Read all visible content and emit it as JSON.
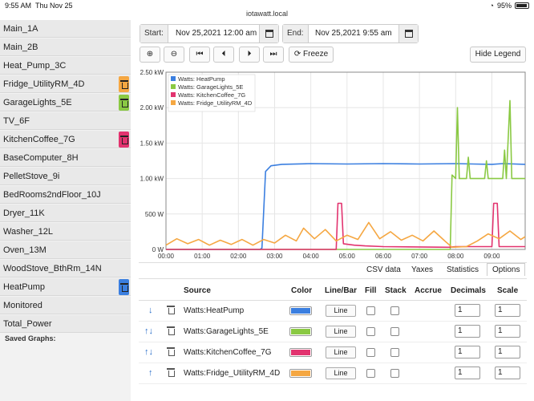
{
  "status": {
    "time": "9:55 AM",
    "date": "Thu Nov 25",
    "battery": "95%"
  },
  "url": "iotawatt.local",
  "sidebar": {
    "items": [
      {
        "label": "Main_1A"
      },
      {
        "label": "Main_2B"
      },
      {
        "label": "Heat_Pump_3C"
      },
      {
        "label": "Fridge_UtilityRM_4D",
        "tag": "#f5a742"
      },
      {
        "label": "GarageLights_5E",
        "tag": "#8ac943"
      },
      {
        "label": "TV_6F"
      },
      {
        "label": "KitchenCoffee_7G",
        "tag": "#e2336f"
      },
      {
        "label": "BaseComputer_8H"
      },
      {
        "label": "PelletStove_9i"
      },
      {
        "label": "BedRooms2ndFloor_10J"
      },
      {
        "label": "Dryer_11K"
      },
      {
        "label": "Washer_12L"
      },
      {
        "label": "Oven_13M"
      },
      {
        "label": "WoodStove_BthRm_14N"
      },
      {
        "label": "HeatPump",
        "tag": "#3b7fe0"
      },
      {
        "label": "Monitored"
      },
      {
        "label": "Total_Power"
      }
    ],
    "saved_label": "Saved Graphs:"
  },
  "controls": {
    "start_label": "Start:",
    "start_value": "Nov 25,2021 12:00 am",
    "end_label": "End:",
    "end_value": "Nov 25,2021 9:55 am",
    "freeze_label": "Freeze",
    "hide_legend_label": "Hide Legend"
  },
  "chart_data": {
    "type": "line",
    "ylabel": "",
    "yticks": [
      "0 W",
      "500 W",
      "1.00 kW",
      "1.50 kW",
      "2.00 kW",
      "2.50 kW"
    ],
    "ylim": [
      0,
      2500
    ],
    "xticks": [
      "00:00",
      "01:00",
      "02:00",
      "03:00",
      "04:00",
      "05:00",
      "06:00",
      "07:00",
      "08:00",
      "09:00"
    ],
    "xlim": [
      0,
      9.92
    ],
    "legend_position": "top-left",
    "series": [
      {
        "name": "Watts: HeatPump",
        "color": "#3b7fe0",
        "points": [
          [
            0,
            0
          ],
          [
            2.6,
            0
          ],
          [
            2.65,
            20
          ],
          [
            2.75,
            1100
          ],
          [
            2.9,
            1180
          ],
          [
            3.2,
            1200
          ],
          [
            4,
            1210
          ],
          [
            5,
            1205
          ],
          [
            6,
            1210
          ],
          [
            7,
            1205
          ],
          [
            8,
            1210
          ],
          [
            8.5,
            1205
          ],
          [
            9,
            1200
          ],
          [
            9.3,
            1210
          ],
          [
            9.92,
            1200
          ]
        ]
      },
      {
        "name": "Watts: GarageLights_5E",
        "color": "#8ac943",
        "points": [
          [
            0,
            0
          ],
          [
            7.85,
            0
          ],
          [
            7.9,
            1050
          ],
          [
            8,
            1000
          ],
          [
            8.05,
            2000
          ],
          [
            8.1,
            1000
          ],
          [
            8.3,
            1000
          ],
          [
            8.35,
            1300
          ],
          [
            8.4,
            1000
          ],
          [
            8.8,
            1000
          ],
          [
            8.85,
            1250
          ],
          [
            8.9,
            1000
          ],
          [
            9.3,
            1000
          ],
          [
            9.35,
            1400
          ],
          [
            9.4,
            1000
          ],
          [
            9.5,
            2100
          ],
          [
            9.55,
            1000
          ],
          [
            9.92,
            1000
          ]
        ]
      },
      {
        "name": "Watts: KitchenCoffee_7G",
        "color": "#e2336f",
        "points": [
          [
            0,
            0
          ],
          [
            4.7,
            0
          ],
          [
            4.75,
            650
          ],
          [
            4.85,
            650
          ],
          [
            4.9,
            80
          ],
          [
            5.2,
            60
          ],
          [
            5.5,
            50
          ],
          [
            6,
            40
          ],
          [
            7.8,
            30
          ],
          [
            8,
            40
          ],
          [
            9.0,
            40
          ],
          [
            9.05,
            650
          ],
          [
            9.15,
            650
          ],
          [
            9.2,
            40
          ],
          [
            9.92,
            40
          ]
        ]
      },
      {
        "name": "Watts: Fridge_UtilityRM_4D",
        "color": "#f5a742",
        "points": [
          [
            0,
            60
          ],
          [
            0.3,
            150
          ],
          [
            0.6,
            80
          ],
          [
            0.9,
            140
          ],
          [
            1.2,
            60
          ],
          [
            1.5,
            130
          ],
          [
            1.8,
            70
          ],
          [
            2.1,
            140
          ],
          [
            2.4,
            60
          ],
          [
            2.7,
            140
          ],
          [
            3,
            90
          ],
          [
            3.3,
            200
          ],
          [
            3.6,
            120
          ],
          [
            3.8,
            300
          ],
          [
            4.1,
            150
          ],
          [
            4.4,
            280
          ],
          [
            4.7,
            120
          ],
          [
            5,
            200
          ],
          [
            5.3,
            140
          ],
          [
            5.6,
            380
          ],
          [
            5.9,
            150
          ],
          [
            6.2,
            250
          ],
          [
            6.5,
            130
          ],
          [
            6.8,
            200
          ],
          [
            7.1,
            120
          ],
          [
            7.4,
            260
          ],
          [
            7.7,
            120
          ],
          [
            7.9,
            30
          ],
          [
            8.3,
            40
          ],
          [
            8.6,
            120
          ],
          [
            8.9,
            220
          ],
          [
            9.2,
            150
          ],
          [
            9.5,
            260
          ],
          [
            9.8,
            140
          ],
          [
            9.92,
            180
          ]
        ]
      }
    ]
  },
  "table": {
    "tabs": [
      "CSV data",
      "Yaxes",
      "Statistics",
      "Options"
    ],
    "headers": {
      "source": "Source",
      "color": "Color",
      "linebar": "Line/Bar",
      "fill": "Fill",
      "stack": "Stack",
      "accrue": "Accrue",
      "decimals": "Decimals",
      "scale": "Scale"
    },
    "rows": [
      {
        "arrows": "↓",
        "source": "Watts:HeatPump",
        "color": "#3b7fe0",
        "type": "Line",
        "decimals": "1",
        "scale": "1"
      },
      {
        "arrows": "↑↓",
        "source": "Watts:GarageLights_5E",
        "color": "#8ac943",
        "type": "Line",
        "decimals": "1",
        "scale": "1"
      },
      {
        "arrows": "↑↓",
        "source": "Watts:KitchenCoffee_7G",
        "color": "#e2336f",
        "type": "Line",
        "decimals": "1",
        "scale": "1"
      },
      {
        "arrows": "↑",
        "source": "Watts:Fridge_UtilityRM_4D",
        "color": "#f5a742",
        "type": "Line",
        "decimals": "1",
        "scale": "1"
      }
    ]
  }
}
